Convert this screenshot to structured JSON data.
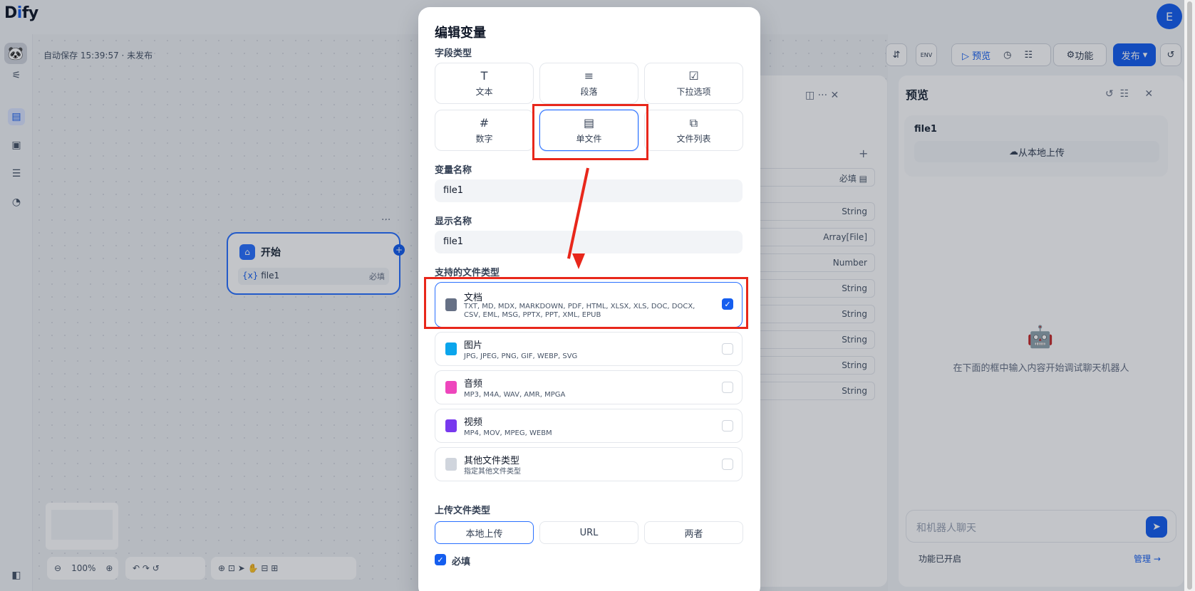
{
  "app": {
    "logo_prefix": "D",
    "logo_highlight": "i",
    "logo_suffix": "fy",
    "user_initial": "E"
  },
  "header": {
    "autosave": "自动保存 15:39:57 · 未发布",
    "env_label": "ENV",
    "preview_label": "预览",
    "features_label": "功能",
    "publish_label": "发布"
  },
  "start_node": {
    "title": "开始",
    "var_prefix": "{x}",
    "var_name": "file1",
    "required": "必填"
  },
  "zoom": "100%",
  "mid_panel": {
    "required": "必填",
    "types": [
      "String",
      "Array[File]",
      "Number",
      "String",
      "String",
      "String",
      "String",
      "String"
    ]
  },
  "preview": {
    "title": "预览",
    "var_label": "file1",
    "upload_label": "从本地上传",
    "empty_text": "在下面的框中输入内容开始调试聊天机器人",
    "chat_placeholder": "和机器人聊天",
    "features_on": "功能已开启",
    "manage": "管理 →"
  },
  "modal": {
    "title": "编辑变量",
    "field_type_label": "字段类型",
    "field_types": [
      {
        "label": "文本",
        "icon": "T"
      },
      {
        "label": "段落",
        "icon": "≡"
      },
      {
        "label": "下拉选项",
        "icon": "☑"
      },
      {
        "label": "数字",
        "icon": "#"
      },
      {
        "label": "单文件",
        "icon": "▤"
      },
      {
        "label": "文件列表",
        "icon": "⧉"
      }
    ],
    "var_name_label": "变量名称",
    "var_name_value": "file1",
    "display_name_label": "显示名称",
    "display_name_value": "file1",
    "supported_label": "支持的文件类型",
    "file_types": [
      {
        "name": "文档",
        "exts": "TXT, MD, MDX, MARKDOWN, PDF, HTML, XLSX, XLS, DOC, DOCX, CSV, EML, MSG, PPTX, PPT, XML, EPUB",
        "color": "#667085",
        "checked": true
      },
      {
        "name": "图片",
        "exts": "JPG, JPEG, PNG, GIF, WEBP, SVG",
        "color": "#0ba5ec",
        "checked": false
      },
      {
        "name": "音频",
        "exts": "MP3, M4A, WAV, AMR, MPGA",
        "color": "#ee46bc",
        "checked": false
      },
      {
        "name": "视频",
        "exts": "MP4, MOV, MPEG, WEBM",
        "color": "#7839ee",
        "checked": false
      },
      {
        "name": "其他文件类型",
        "exts": "指定其他文件类型",
        "color": "#d0d5dd",
        "checked": false
      }
    ],
    "upload_type_label": "上传文件类型",
    "upload_types": [
      "本地上传",
      "URL",
      "两者"
    ],
    "required_label": "必填"
  },
  "colors": {
    "accent": "#155eef",
    "annotation": "#e8271b"
  }
}
